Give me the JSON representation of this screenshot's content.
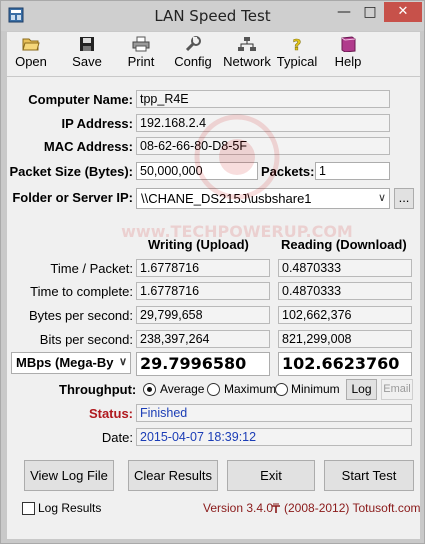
{
  "window": {
    "title": "LAN Speed Test"
  },
  "toolbar": {
    "items": [
      {
        "label": "Open",
        "icon": "folder-open-icon"
      },
      {
        "label": "Save",
        "icon": "floppy-disk-icon"
      },
      {
        "label": "Print",
        "icon": "printer-icon"
      },
      {
        "label": "Config",
        "icon": "wrench-icon"
      },
      {
        "label": "Network",
        "icon": "network-icon"
      },
      {
        "label": "Typical",
        "icon": "help-icon"
      },
      {
        "label": "Help",
        "icon": "book-icon"
      }
    ]
  },
  "info": {
    "computer_name_label": "Computer Name:",
    "computer_name": "tpp_R4E",
    "ip_label": "IP Address:",
    "ip": "192.168.2.4",
    "mac_label": "MAC Address:",
    "mac": "08-62-66-80-D8-5F",
    "packet_size_label": "Packet Size (Bytes):",
    "packet_size": "50,000,000",
    "packets_label": "Packets:",
    "packets": "1",
    "folder_label": "Folder or Server IP:",
    "folder": "\\\\CHANE_DS215J\\usbshare1",
    "browse_label": "..."
  },
  "results": {
    "writing_header": "Writing (Upload)",
    "reading_header": "Reading (Download)",
    "rows": [
      {
        "label": "Time / Packet:",
        "write": "1.6778716",
        "read": "0.4870333"
      },
      {
        "label": "Time to complete:",
        "write": "1.6778716",
        "read": "0.4870333"
      },
      {
        "label": "Bytes per second:",
        "write": "29,799,658",
        "read": "102,662,376"
      },
      {
        "label": "Bits per second:",
        "write": "238,397,264",
        "read": "821,299,008"
      }
    ],
    "unit_select": "MBps (Mega-By",
    "write_big": "29.7996580",
    "read_big": "102.6623760"
  },
  "throughput": {
    "label": "Throughput:",
    "options": [
      "Average",
      "Maximum",
      "Minimum"
    ],
    "selected": "Average",
    "log_label": "Log",
    "email_label": "Email"
  },
  "status": {
    "label": "Status:",
    "value": "Finished"
  },
  "date": {
    "label": "Date:",
    "value": "2015-04-07 18:39:12"
  },
  "buttons": {
    "view_log": "View Log File",
    "clear": "Clear Results",
    "exit": "Exit",
    "start": "Start Test"
  },
  "footer": {
    "log_results": "Log Results",
    "version": "Version 3.4.0",
    "copyright": "(2008-2012) Totusoft.com"
  },
  "colors": {
    "status_label": "#b0191e",
    "blue_value": "#1b3db6",
    "close_button": "#c7514a"
  }
}
